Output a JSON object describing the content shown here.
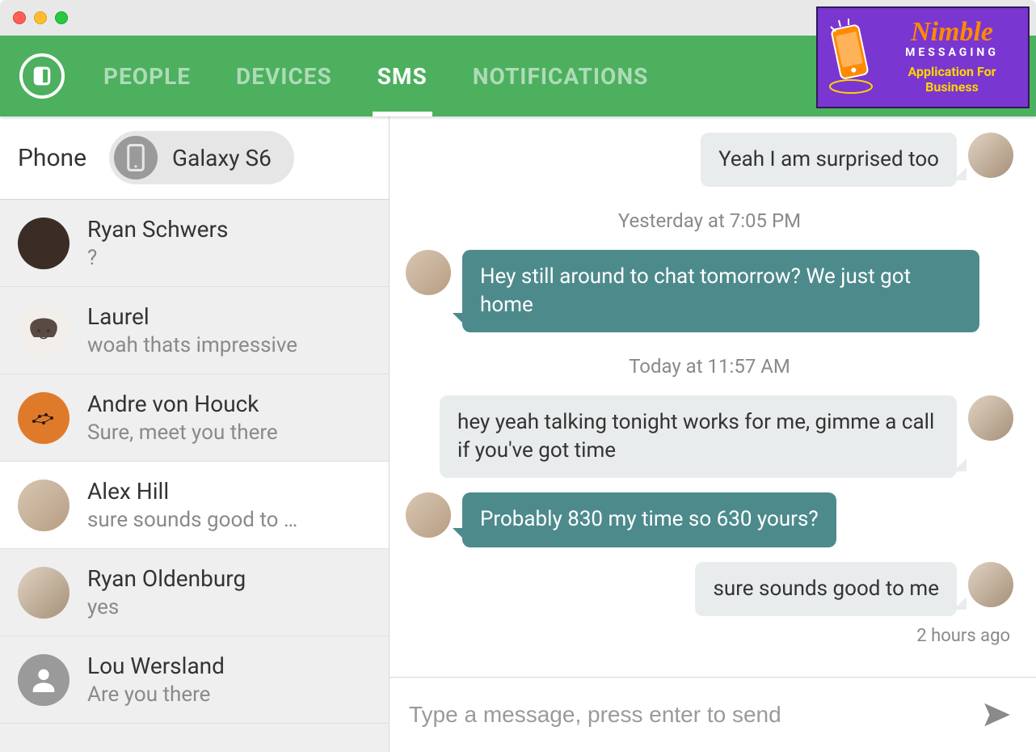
{
  "nav": {
    "tabs": [
      "PEOPLE",
      "DEVICES",
      "SMS",
      "NOTIFICATIONS"
    ],
    "active_index": 2
  },
  "phone_selector": {
    "label": "Phone",
    "device_name": "Galaxy S6"
  },
  "threads": [
    {
      "name": "Ryan Schwers",
      "preview": "?",
      "avatar_class": "av-dark"
    },
    {
      "name": "Laurel",
      "preview": "woah thats impressive",
      "avatar_class": "av-light"
    },
    {
      "name": "Andre von Houck",
      "preview": "Sure, meet you there",
      "avatar_class": "av-orange"
    },
    {
      "name": "Alex Hill",
      "preview": "sure sounds good to …",
      "avatar_class": "av-photo1",
      "active": true
    },
    {
      "name": "Ryan Oldenburg",
      "preview": "yes",
      "avatar_class": "av-photo2"
    },
    {
      "name": "Lou Wersland",
      "preview": "Are you there",
      "avatar_class": "av-gray"
    }
  ],
  "conversation": {
    "items": [
      {
        "type": "message",
        "direction": "in",
        "text": "Yeah I am surprised too",
        "show_avatar": true
      },
      {
        "type": "divider",
        "text": "Yesterday at 7:05 PM"
      },
      {
        "type": "message",
        "direction": "mine",
        "text": "Hey still around to chat tomorrow? We just got home",
        "show_avatar": true
      },
      {
        "type": "divider",
        "text": "Today at 11:57 AM"
      },
      {
        "type": "message",
        "direction": "in",
        "text": "hey yeah talking tonight works for me, gimme a call if you've got time",
        "show_avatar": true
      },
      {
        "type": "message",
        "direction": "mine",
        "text": "Probably 830 my time so 630 yours?",
        "show_avatar": true
      },
      {
        "type": "message",
        "direction": "in",
        "text": "sure sounds good to me",
        "show_avatar": true
      }
    ],
    "last_meta": "2 hours ago"
  },
  "composer": {
    "placeholder": "Type a message, press enter to send"
  },
  "promo": {
    "title": "Nimble",
    "sub1": "MESSAGING",
    "sub2": "Application For Business"
  }
}
